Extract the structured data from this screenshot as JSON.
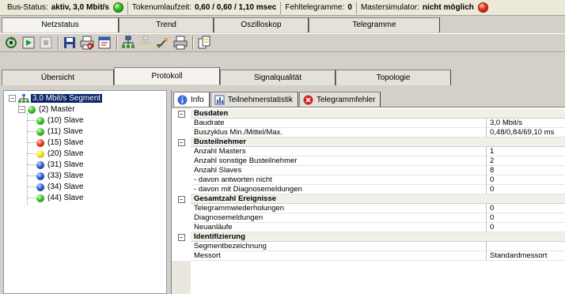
{
  "status": {
    "bus_label": "Bus-Status:",
    "bus_value": "aktiv, 3,0 Mbit/s",
    "token_label": "Tokenumlaufzeit:",
    "token_value": "0,60 / 0,60 / 1,10 msec",
    "errors_label": "Fehltelegramme:",
    "errors_value": "0",
    "master_label": "Mastersimulator:",
    "master_value": "nicht möglich",
    "bus_led_color": "#3fc12f",
    "master_led_color": "#f03c20"
  },
  "main_tabs": [
    {
      "label": "Netzstatus",
      "active": true
    },
    {
      "label": "Trend",
      "active": false
    },
    {
      "label": "Oszilloskop",
      "active": false
    },
    {
      "label": "Telegramme",
      "active": false
    }
  ],
  "toolbar_icons": [
    "scan-network-icon",
    "play-icon",
    "stop-icon",
    "save-icon",
    "print-preview-icon",
    "export-icon",
    "network-live-icon",
    "network-offline-icon",
    "settings-tool-icon",
    "print-icon",
    "copy-icon"
  ],
  "sub_tabs": [
    {
      "label": "Übersicht",
      "active": false
    },
    {
      "label": "Protokoll",
      "active": true
    },
    {
      "label": "Signalqualität",
      "active": false
    },
    {
      "label": "Topologie",
      "active": false
    }
  ],
  "tree": {
    "segment": "3,0 Mbit/s Segment",
    "master": "(2) Master",
    "slaves": [
      {
        "label": "(10) Slave",
        "status": "green"
      },
      {
        "label": "(11) Slave",
        "status": "green"
      },
      {
        "label": "(15) Slave",
        "status": "red"
      },
      {
        "label": "(20) Slave",
        "status": "yellow"
      },
      {
        "label": "(31) Slave",
        "status": "blue"
      },
      {
        "label": "(33) Slave",
        "status": "blue"
      },
      {
        "label": "(34) Slave",
        "status": "blue"
      },
      {
        "label": "(44) Slave",
        "status": "green"
      }
    ]
  },
  "detail_tabs": [
    {
      "label": "Info",
      "icon": "info-icon",
      "active": true
    },
    {
      "label": "Teilnehmerstatistik",
      "icon": "statistics-icon",
      "active": false
    },
    {
      "label": "Telegrammfehler",
      "icon": "error-icon",
      "active": false
    }
  ],
  "sections": [
    {
      "title": "Busdaten",
      "rows": [
        {
          "key": "Baudrate",
          "value": "3,0 Mbit/s"
        },
        {
          "key": "Buszyklus Min./Mittel/Max.",
          "value": "0,48/0,84/69,10 ms"
        }
      ]
    },
    {
      "title": "Busteilnehmer",
      "rows": [
        {
          "key": "Anzahl Masters",
          "value": "1"
        },
        {
          "key": "Anzahl sonstige Busteilnehmer",
          "value": "2"
        },
        {
          "key": "Anzahl Slaves",
          "value": "8"
        },
        {
          "key": "- davon antworten nicht",
          "value": "0"
        },
        {
          "key": "- davon mit Diagnosemeldungen",
          "value": "0"
        }
      ]
    },
    {
      "title": "Gesamtzahl Ereignisse",
      "rows": [
        {
          "key": "Telegrammwiederholungen",
          "value": "0"
        },
        {
          "key": "Diagnosemeldungen",
          "value": "0"
        },
        {
          "key": "Neuanläufe",
          "value": "0"
        }
      ]
    },
    {
      "title": "Identifizierung",
      "rows": [
        {
          "key": "Segmentbezeichnung",
          "value": ""
        },
        {
          "key": "Messort",
          "value": "Standardmessort"
        }
      ]
    }
  ]
}
